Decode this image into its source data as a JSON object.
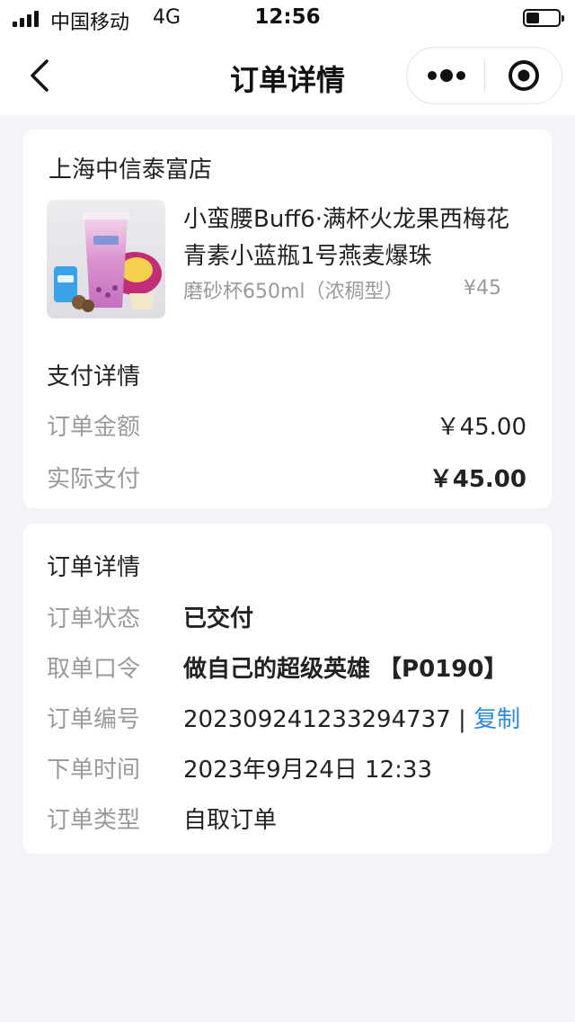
{
  "status_bar": {
    "carrier": "中国移动",
    "network": "4G",
    "time": "12:56"
  },
  "nav": {
    "title": "订单详情",
    "back_icon": "chevron-left-icon",
    "more_icon": "more-dots-icon",
    "close_icon": "target-close-icon"
  },
  "order": {
    "store_name": "上海中信泰富店",
    "product": {
      "name": "小蛮腰Buff6·满杯火龙果西梅花青素小蓝瓶1号燕麦爆珠",
      "spec": "磨砂杯650ml（浓稠型）",
      "price": "¥45"
    },
    "payment": {
      "title": "支付详情",
      "amount_label": "订单金额",
      "amount_value": "￥45.00",
      "paid_label": "实际支付",
      "paid_value": "￥45.00"
    },
    "details": {
      "title": "订单详情",
      "rows": [
        {
          "label": "订单状态",
          "value": "已交付"
        },
        {
          "label": "取单口令",
          "value": "做自己的超级英雄 【P0190】"
        },
        {
          "label": "订单编号",
          "value": "20230924123329473​7"
        },
        {
          "label": "下单时间",
          "value": "2023年9月24日 12:33"
        },
        {
          "label": "订单类型",
          "value": "自取订单"
        }
      ],
      "copy_separator": "|",
      "copy_label": "复制"
    }
  },
  "colors": {
    "accent_link": "#2d8bd8",
    "muted_text": "#9a9a9a",
    "page_bg": "#f3f4f8"
  }
}
